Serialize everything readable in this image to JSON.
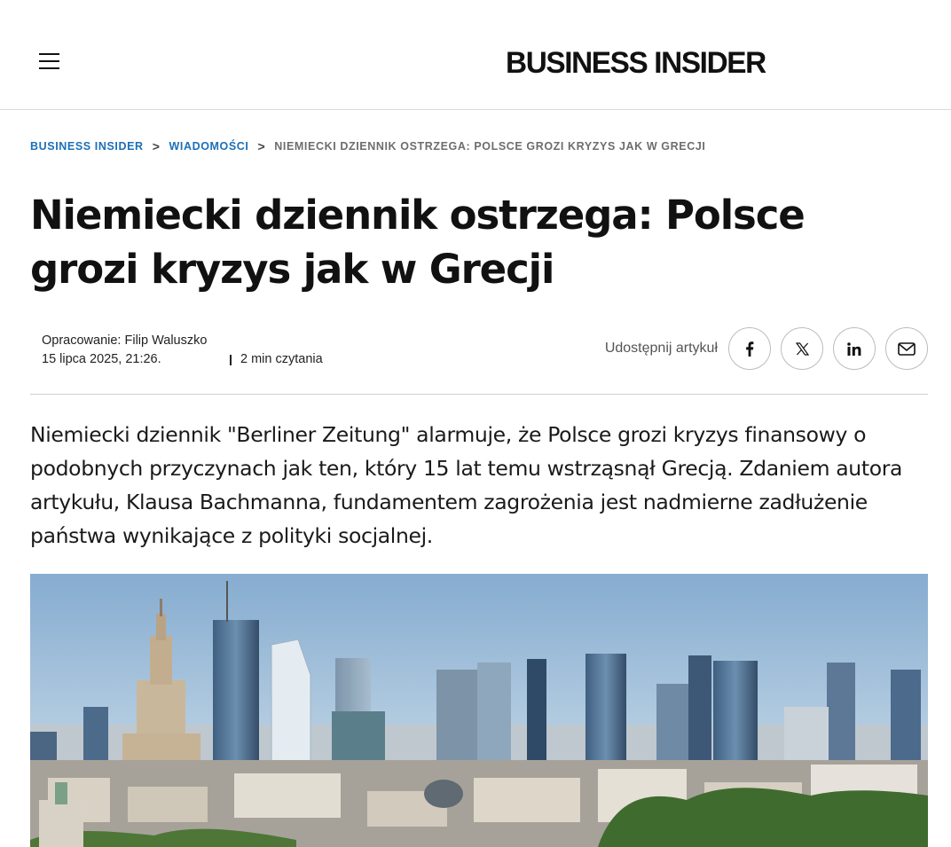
{
  "header": {
    "logo": "BUSINESS INSIDER",
    "menu_icon": "hamburger-menu-icon"
  },
  "breadcrumb": {
    "items": [
      "BUSINESS INSIDER",
      "WIADOMOŚCI",
      "NIEMIECKI DZIENNIK OSTRZEGA: POLSCE GROZI KRYZYS JAK W GRECJI"
    ],
    "separator": ">"
  },
  "article": {
    "title": "Niemiecki dziennik ostrzega: Polsce grozi kryzys jak w Grecji",
    "author": "Opracowanie: Filip Waluszko",
    "date": "15 lipca 2025, 21:26.",
    "read_time": "2 min czytania",
    "lead": "Niemiecki dziennik \"Berliner Zeitung\" alarmuje, że Polsce grozi kryzys finansowy o podobnych przyczynach jak ten, który 15 lat temu wstrząsnął Grecją. Zdaniem autora artykułu, Klausa Bachmanna, fundamentem zagrożenia jest nadmierne zadłużenie państwa wynikające z polityki socjalnej."
  },
  "share": {
    "label": "Udostępnij artykuł",
    "buttons": [
      {
        "icon": "facebook-icon"
      },
      {
        "icon": "x-icon"
      },
      {
        "icon": "linkedin-icon"
      },
      {
        "icon": "mail-icon"
      }
    ]
  },
  "colors": {
    "link": "#1d6fb8",
    "text": "#111111",
    "muted": "#6d6d6d",
    "border": "#d9d9d9"
  }
}
